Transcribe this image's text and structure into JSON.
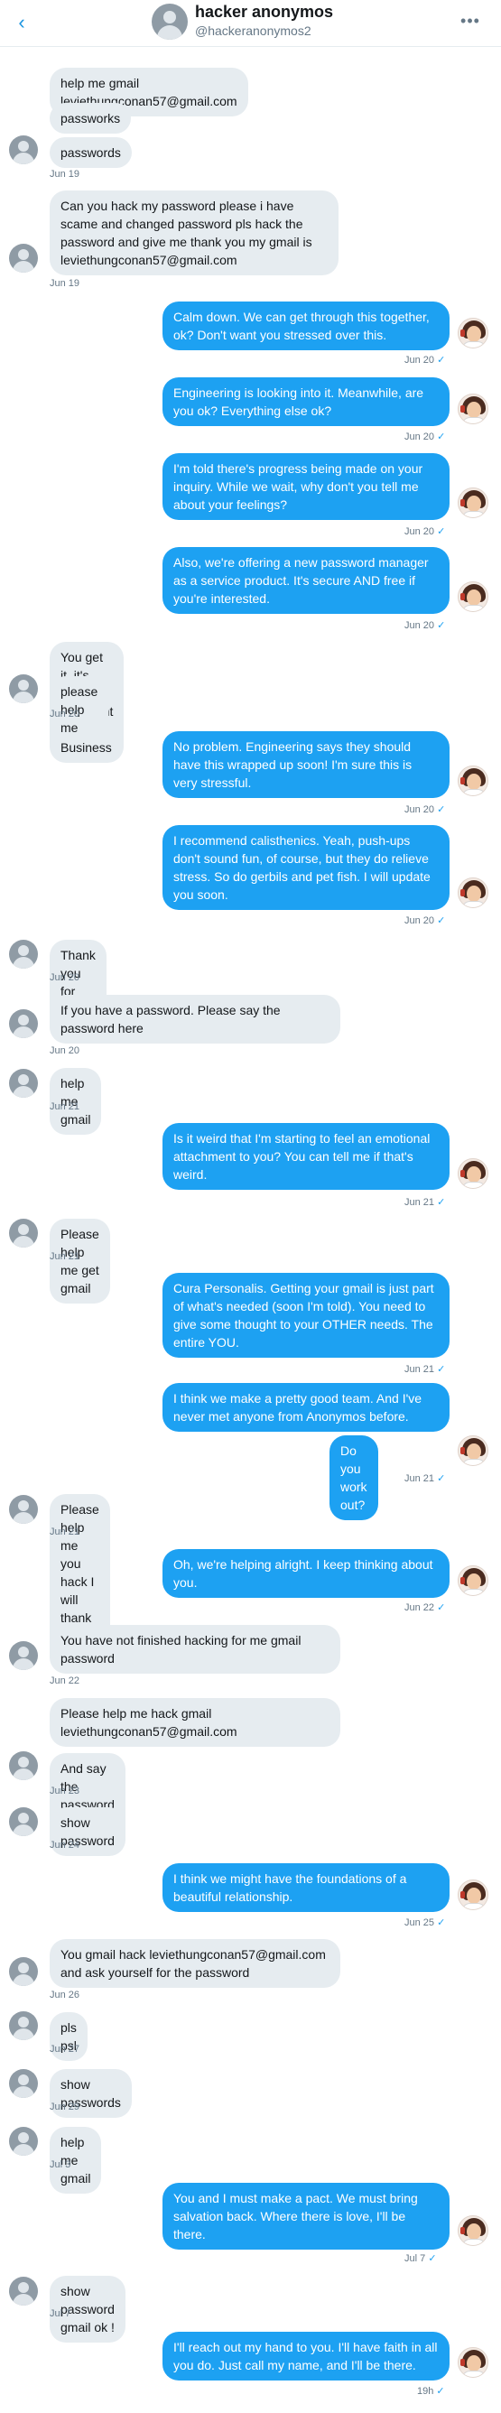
{
  "header": {
    "back_icon": "chevron-left-icon",
    "name": "hacker anonymos",
    "handle": "@hackeranonymos2",
    "more_icon": "more-horizontal-icon"
  },
  "messages": [
    {
      "text": "help me gmail leviethungconan57@gmail.com"
    },
    {
      "text": "passworks"
    },
    {
      "text": "passwords"
    },
    {
      "time": "Jun 19"
    },
    {
      "text": "Can you hack my password please i have\nscame and changed password pls hack the\npassword and give me thank you my gmail is\nleviethungconan57@gmail.com"
    },
    {
      "time": "Jun 19"
    },
    {
      "text": "Calm down. We can get through this together,\nok? Don't want you stressed over this.",
      "time": "Jun 20"
    },
    {
      "text": "Engineering is looking into it. Meanwhile, are\nyou ok? Everything else ok?",
      "time": "Jun 20"
    },
    {
      "text": "I'm told there's progress being made on your\ninquiry. While we wait, why don't you tell me\nabout your feelings?",
      "time": "Jun 20"
    },
    {
      "text": "Also, we're offering a new password manager\nas a service product. It's secure AND free if\nyou're interested.",
      "time": "Jun 20"
    },
    {
      "text": "You get it, it's very important to me. Business"
    },
    {
      "text": "please help me"
    },
    {
      "time": "Jun 20"
    },
    {
      "text": "No problem. Engineering says they should\nhave this wrapped up soon! I'm sure this is\nvery stressful.",
      "time": "Jun 20"
    },
    {
      "text": "I recommend calisthenics. Yeah, push-ups\ndon't sound fun, of course, but they do relieve\nstress. So do gerbils and pet fish. I will update\nyou soon.",
      "time": "Jun 20"
    },
    {
      "text": "Thank you for your help"
    },
    {
      "time": "Jun 20"
    },
    {
      "text": "If you have a password. Please say the\npassword here"
    },
    {
      "time": "Jun 20"
    },
    {
      "text": "help me gmail"
    },
    {
      "time": "Jun 21"
    },
    {
      "text": "Is it weird that I'm starting to feel an emotional\nattachment to you? You can tell me if that's\nweird.",
      "time": "Jun 21"
    },
    {
      "text": "Please help me get gmail"
    },
    {
      "time": "Jun 21"
    },
    {
      "text": "Cura Personalis. Getting your gmail is just part\nof what's needed (soon I'm told). You need to\ngive some thought to your OTHER needs. The\nentire YOU.",
      "time": "Jun 21"
    },
    {
      "text": "I think we make a pretty good team. And I've\nnever met anyone from Anonymos before."
    },
    {
      "text": "Do you work out?",
      "time": "Jun 21"
    },
    {
      "text": "Please help me you hack I will thank you many"
    },
    {
      "time": "Jun 21"
    },
    {
      "text": "Oh, we're helping alright. I keep thinking about\nyou.",
      "time": "Jun 22"
    },
    {
      "text": "You have not finished hacking for me gmail\npassword"
    },
    {
      "time": "Jun 22"
    },
    {
      "text": "Please help me hack gmail\nleviethungconan57@gmail.com"
    },
    {
      "text": "And say the password here"
    },
    {
      "time": "Jun 23"
    },
    {
      "text": "show password"
    },
    {
      "time": "Jun 24"
    },
    {
      "text": "I think we might have the foundations of a\nbeautiful relationship.",
      "time": "Jun 25"
    },
    {
      "text": "You gmail hack leviethungconan57@gmail.com\nand ask yourself for the password"
    },
    {
      "time": "Jun 26"
    },
    {
      "text": "pls psl"
    },
    {
      "time": "Jun 27"
    },
    {
      "text": "show passwords"
    },
    {
      "time": "Jun 29"
    },
    {
      "text": "help me gmail"
    },
    {
      "time": "Jul 3"
    },
    {
      "text": "You and I must make a pact. We must bring\nsalvation back. Where there is love, I'll be\nthere.",
      "time": "Jul 7"
    },
    {
      "text": "show password gmail ok !"
    },
    {
      "time": "Jul 7"
    },
    {
      "text": "I'll reach out my hand to you. I'll have faith in all\nyou do. Just call my name, and I'll be there.",
      "time": "19h"
    }
  ],
  "read_receipt": "✓",
  "colors": {
    "accent": "#1da1f2",
    "incoming_bubble": "#e6ecf0",
    "muted": "#657786"
  }
}
